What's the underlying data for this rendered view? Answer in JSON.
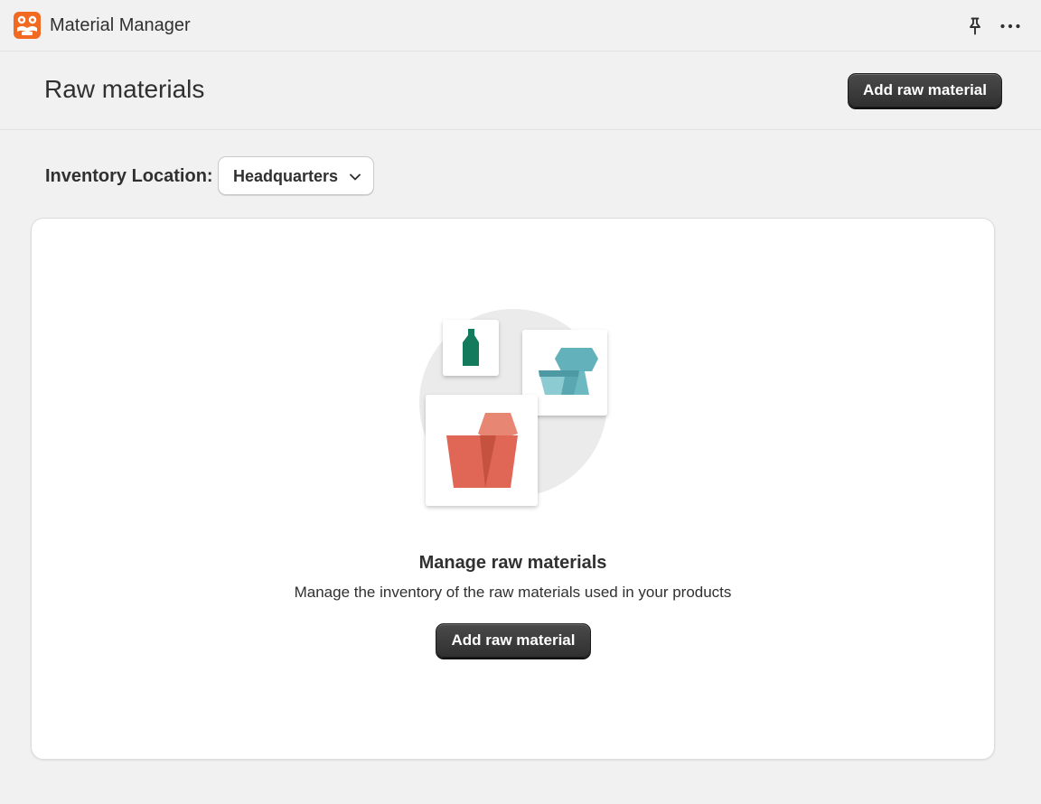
{
  "app": {
    "title": "Material Manager",
    "logo_icon": "flower-logo-icon",
    "logo_color": "#f26a21",
    "actions": [
      {
        "icon": "pin-icon"
      },
      {
        "icon": "more-horizontal-icon"
      }
    ]
  },
  "page": {
    "title": "Raw materials",
    "primary_action_label": "Add raw material"
  },
  "location": {
    "label": "Inventory Location:",
    "selected": "Headquarters",
    "icon": "chevron-down-icon"
  },
  "empty_state": {
    "illustration": "raw-materials-illustration",
    "title": "Manage raw materials",
    "description": "Manage the inventory of the raw materials used in your products",
    "action_label": "Add raw material"
  },
  "colors": {
    "background": "#f1f1f1",
    "surface": "#ffffff",
    "button": "#303030",
    "button_text": "#ffffff",
    "bottle_green": "#137a5b",
    "bowl_teal": "#63b1bb",
    "cup_red": "#e06656"
  }
}
